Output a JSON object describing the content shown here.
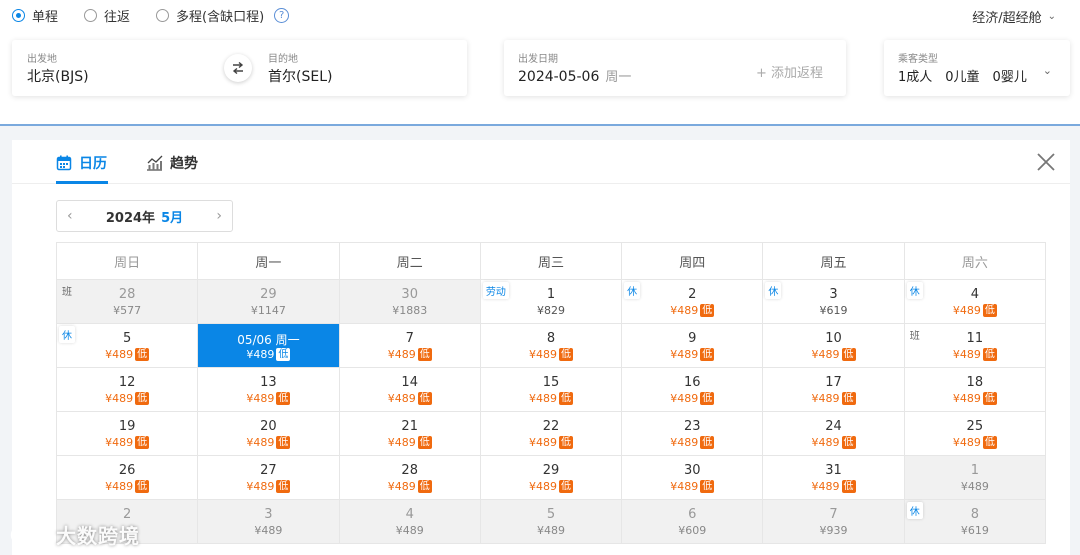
{
  "trip_types": [
    {
      "label": "单程",
      "selected": true
    },
    {
      "label": "往返",
      "selected": false
    },
    {
      "label": "多程(含缺口程)",
      "selected": false
    }
  ],
  "cabin": "经济/超经舱",
  "search": {
    "from_label": "出发地",
    "from_value": "北京(BJS)",
    "to_label": "目的地",
    "to_value": "首尔(SEL)",
    "date_label": "出发日期",
    "date_value": "2024-05-06",
    "date_weekday": "周一",
    "add_return": "+ 添加返程",
    "pax_label": "乘客类型",
    "pax_value": "1成人　0儿童　0婴儿"
  },
  "tabs": [
    {
      "label": "日历",
      "active": true
    },
    {
      "label": "趋势",
      "active": false
    }
  ],
  "month_nav": {
    "year": "2024年",
    "month": "5月"
  },
  "weekdays": [
    "周日",
    "周一",
    "周二",
    "周三",
    "周四",
    "周五",
    "周六"
  ],
  "weeks": [
    [
      {
        "day": "28",
        "price": "¥577",
        "other": true,
        "tag": "班"
      },
      {
        "day": "29",
        "price": "¥1147",
        "other": true
      },
      {
        "day": "30",
        "price": "¥1883",
        "other": true
      },
      {
        "day": "1",
        "price": "¥829",
        "tag": "劳动"
      },
      {
        "day": "2",
        "price": "¥489",
        "low": true,
        "tag": "休"
      },
      {
        "day": "3",
        "price": "¥619",
        "tag": "休"
      },
      {
        "day": "4",
        "price": "¥489",
        "low": true,
        "tag": "休"
      }
    ],
    [
      {
        "day": "5",
        "price": "¥489",
        "low": true,
        "tag": "休"
      },
      {
        "day": "05/06 周一",
        "price": "¥489",
        "low": true,
        "selected": true
      },
      {
        "day": "7",
        "price": "¥489",
        "low": true
      },
      {
        "day": "8",
        "price": "¥489",
        "low": true
      },
      {
        "day": "9",
        "price": "¥489",
        "low": true
      },
      {
        "day": "10",
        "price": "¥489",
        "low": true
      },
      {
        "day": "11",
        "price": "¥489",
        "low": true,
        "tag": "班"
      }
    ],
    [
      {
        "day": "12",
        "price": "¥489",
        "low": true
      },
      {
        "day": "13",
        "price": "¥489",
        "low": true
      },
      {
        "day": "14",
        "price": "¥489",
        "low": true
      },
      {
        "day": "15",
        "price": "¥489",
        "low": true
      },
      {
        "day": "16",
        "price": "¥489",
        "low": true
      },
      {
        "day": "17",
        "price": "¥489",
        "low": true
      },
      {
        "day": "18",
        "price": "¥489",
        "low": true
      }
    ],
    [
      {
        "day": "19",
        "price": "¥489",
        "low": true
      },
      {
        "day": "20",
        "price": "¥489",
        "low": true
      },
      {
        "day": "21",
        "price": "¥489",
        "low": true
      },
      {
        "day": "22",
        "price": "¥489",
        "low": true
      },
      {
        "day": "23",
        "price": "¥489",
        "low": true
      },
      {
        "day": "24",
        "price": "¥489",
        "low": true
      },
      {
        "day": "25",
        "price": "¥489",
        "low": true
      }
    ],
    [
      {
        "day": "26",
        "price": "¥489",
        "low": true
      },
      {
        "day": "27",
        "price": "¥489",
        "low": true
      },
      {
        "day": "28",
        "price": "¥489",
        "low": true
      },
      {
        "day": "29",
        "price": "¥489",
        "low": true
      },
      {
        "day": "30",
        "price": "¥489",
        "low": true
      },
      {
        "day": "31",
        "price": "¥489",
        "low": true
      },
      {
        "day": "1",
        "price": "¥489",
        "other": true
      }
    ],
    [
      {
        "day": "2",
        "price": "",
        "other": true
      },
      {
        "day": "3",
        "price": "¥489",
        "other": true
      },
      {
        "day": "4",
        "price": "¥489",
        "other": true
      },
      {
        "day": "5",
        "price": "¥489",
        "other": true
      },
      {
        "day": "6",
        "price": "¥609",
        "other": true
      },
      {
        "day": "7",
        "price": "¥939",
        "other": true
      },
      {
        "day": "8",
        "price": "¥619",
        "other": true,
        "tag": "休"
      }
    ]
  ],
  "low_badge": "低",
  "watermark": "大数跨境",
  "colors": {
    "accent": "#0a86e6",
    "low_price": "#f06a0f"
  }
}
